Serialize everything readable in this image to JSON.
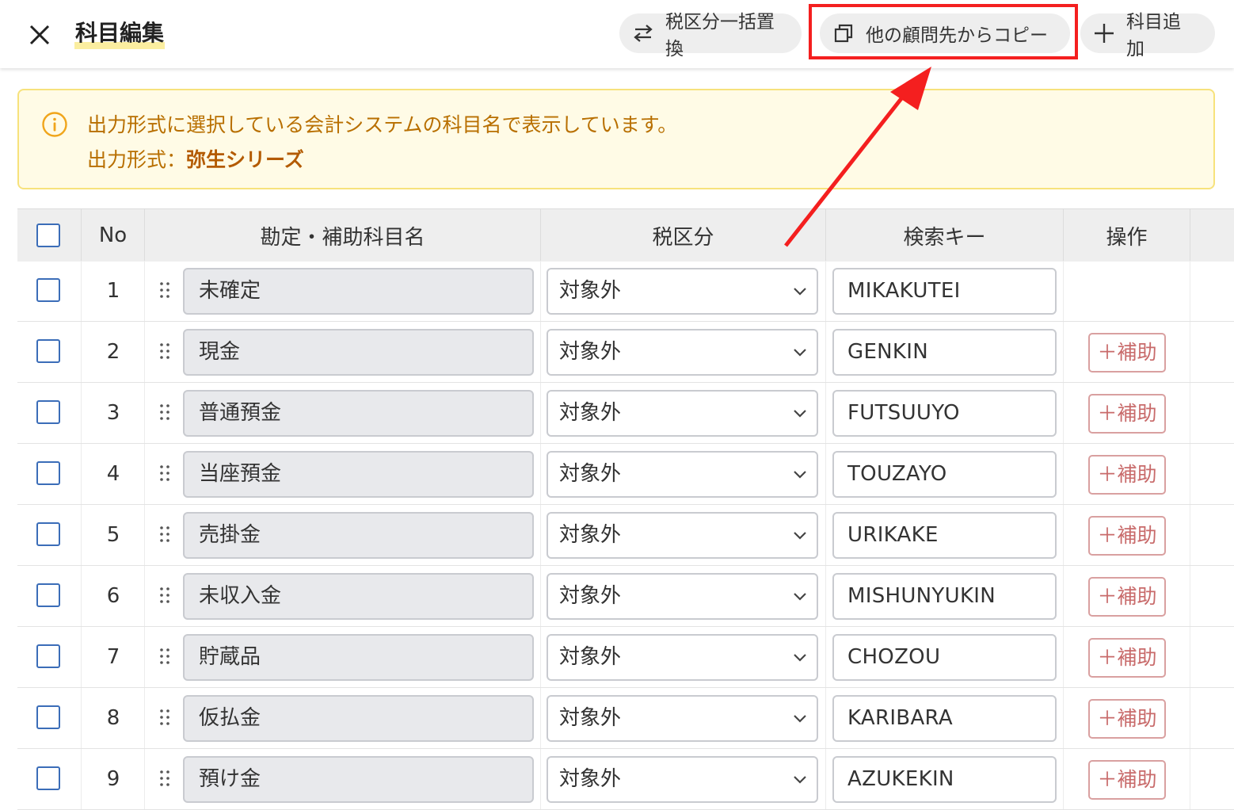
{
  "header": {
    "title": "科目編集",
    "buttons": {
      "tax_replace": "税区分一括置換",
      "copy_from_client": "他の顧問先からコピー",
      "add_account": "科目追加"
    }
  },
  "notice": {
    "message": "出力形式に選択している会計システムの科目名で表示しています。",
    "format_label": "出力形式：",
    "format_value": "弥生シリーズ"
  },
  "table": {
    "columns": [
      "No",
      "勘定・補助科目名",
      "税区分",
      "検索キー",
      "操作"
    ],
    "sub_button_label": "＋補助",
    "rows": [
      {
        "no": "1",
        "name": "未確定",
        "tax": "対象外",
        "key": "MIKAKUTEI",
        "has_sub_button": false
      },
      {
        "no": "2",
        "name": "現金",
        "tax": "対象外",
        "key": "GENKIN",
        "has_sub_button": true
      },
      {
        "no": "3",
        "name": "普通預金",
        "tax": "対象外",
        "key": "FUTSUUYO",
        "has_sub_button": true
      },
      {
        "no": "4",
        "name": "当座預金",
        "tax": "対象外",
        "key": "TOUZAYO",
        "has_sub_button": true
      },
      {
        "no": "5",
        "name": "売掛金",
        "tax": "対象外",
        "key": "URIKAKE",
        "has_sub_button": true
      },
      {
        "no": "6",
        "name": "未収入金",
        "tax": "対象外",
        "key": "MISHUNYUKIN",
        "has_sub_button": true
      },
      {
        "no": "7",
        "name": "貯蔵品",
        "tax": "対象外",
        "key": "CHOZOU",
        "has_sub_button": true
      },
      {
        "no": "8",
        "name": "仮払金",
        "tax": "対象外",
        "key": "KARIBARA",
        "has_sub_button": true
      },
      {
        "no": "9",
        "name": "預け金",
        "tax": "対象外",
        "key": "AZUKEKIN",
        "has_sub_button": true
      }
    ]
  },
  "colors": {
    "highlight": "#f41f1f",
    "notice_bg": "#fffbe6",
    "notice_text": "#b86f00",
    "checkbox_border": "#3b6db8",
    "sub_button": "#c86a6a"
  }
}
